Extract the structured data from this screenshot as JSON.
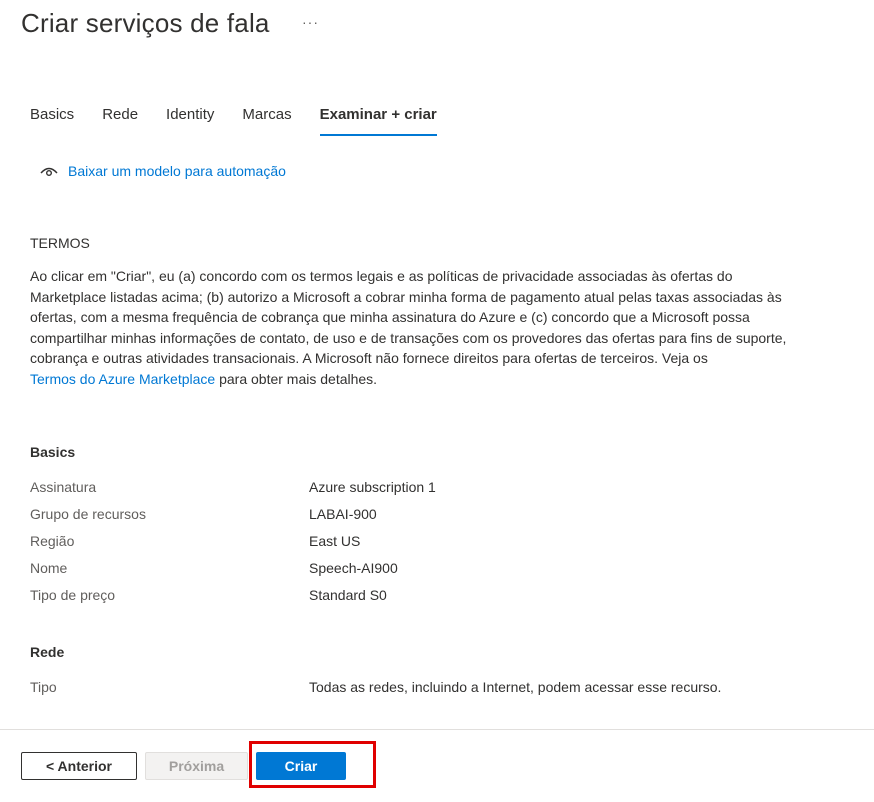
{
  "page": {
    "title": "Criar serviços de fala",
    "more_icon": "ellipsis-icon"
  },
  "tabs": [
    {
      "label": "Basics",
      "active": false
    },
    {
      "label": "Rede",
      "active": false
    },
    {
      "label": "Identity",
      "active": false
    },
    {
      "label": "Marcas",
      "active": false
    },
    {
      "label": "Examinar + criar",
      "active": true
    }
  ],
  "download_link": {
    "label": "Baixar um modelo para automação",
    "icon": "eye-icon"
  },
  "terms": {
    "heading": "TERMOS",
    "body": "Ao clicar em \"Criar\", eu (a) concordo com os termos legais e as políticas de privacidade associadas às ofertas do Marketplace listadas acima; (b) autorizo a Microsoft a cobrar minha forma de pagamento atual pelas taxas associadas às ofertas, com a mesma frequência de cobrança que minha assinatura do Azure e (c) concordo que a Microsoft possa compartilhar minhas informações de contato, de uso e de transações com os provedores das ofertas para fins de suporte, cobrança e outras atividades transacionais. A Microsoft não fornece direitos para ofertas de terceiros. Veja os",
    "link": "Termos do Azure Marketplace",
    "suffix": "para obter mais detalhes."
  },
  "basics": {
    "heading": "Basics",
    "rows": [
      {
        "label": "Assinatura",
        "value": "Azure subscription 1"
      },
      {
        "label": "Grupo de recursos",
        "value": "LABAI-900"
      },
      {
        "label": "Região",
        "value": "East US"
      },
      {
        "label": "Nome",
        "value": "Speech-AI900"
      },
      {
        "label": "Tipo de preço",
        "value": "Standard S0"
      }
    ]
  },
  "rede": {
    "heading": "Rede",
    "rows": [
      {
        "label": "Tipo",
        "value": "Todas as redes, incluindo a Internet, podem acessar esse recurso."
      }
    ]
  },
  "footer": {
    "prev_label": "< Anterior",
    "next_label": "Próxima",
    "create_label": "Criar"
  },
  "colors": {
    "accent": "#0078d4",
    "highlight": "#e00000"
  }
}
